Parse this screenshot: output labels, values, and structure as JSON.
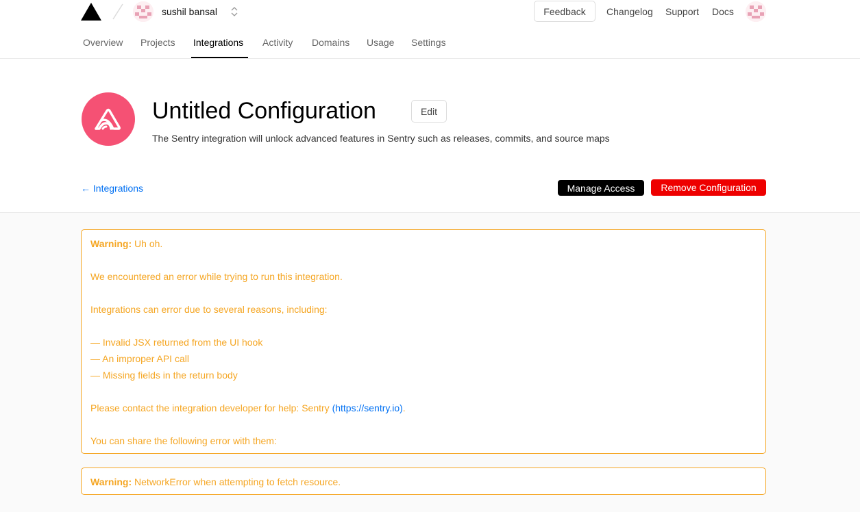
{
  "header": {
    "team_name": "sushil bansal",
    "feedback_label": "Feedback",
    "links": [
      "Changelog",
      "Support",
      "Docs"
    ]
  },
  "tabs": [
    "Overview",
    "Projects",
    "Integrations",
    "Activity",
    "Domains",
    "Usage",
    "Settings"
  ],
  "active_tab": "Integrations",
  "integration": {
    "title": "Untitled Configuration",
    "edit_label": "Edit",
    "description": "The Sentry integration will unlock advanced features in Sentry such as releases, commits, and source maps",
    "icon": "sentry-icon",
    "icon_color": "#f55174"
  },
  "actions": {
    "back_label": "← Integrations",
    "manage_label": "Manage Access",
    "remove_label": "Remove Configuration"
  },
  "error_box": {
    "warning_prefix": "Warning:",
    "headline": " Uh oh.",
    "line1": "We encountered an error while trying to run this integration.",
    "line2": "Integrations can error due to several reasons, including:",
    "reasons": [
      "— Invalid JSX returned from the UI hook",
      "— An improper API call",
      "— Missing fields in the return body"
    ],
    "contact_prefix": "Please contact the integration developer for help: Sentry ",
    "contact_link": "(https://sentry.io)",
    "contact_suffix": ".",
    "share_line": "You can share the following error with them:"
  },
  "network_box": {
    "warning_prefix": "Warning:",
    "message": " NetworkError when attempting to fetch resource."
  },
  "colors": {
    "warning": "#f5a623",
    "link": "#0070f3",
    "danger": "#ee0000"
  }
}
